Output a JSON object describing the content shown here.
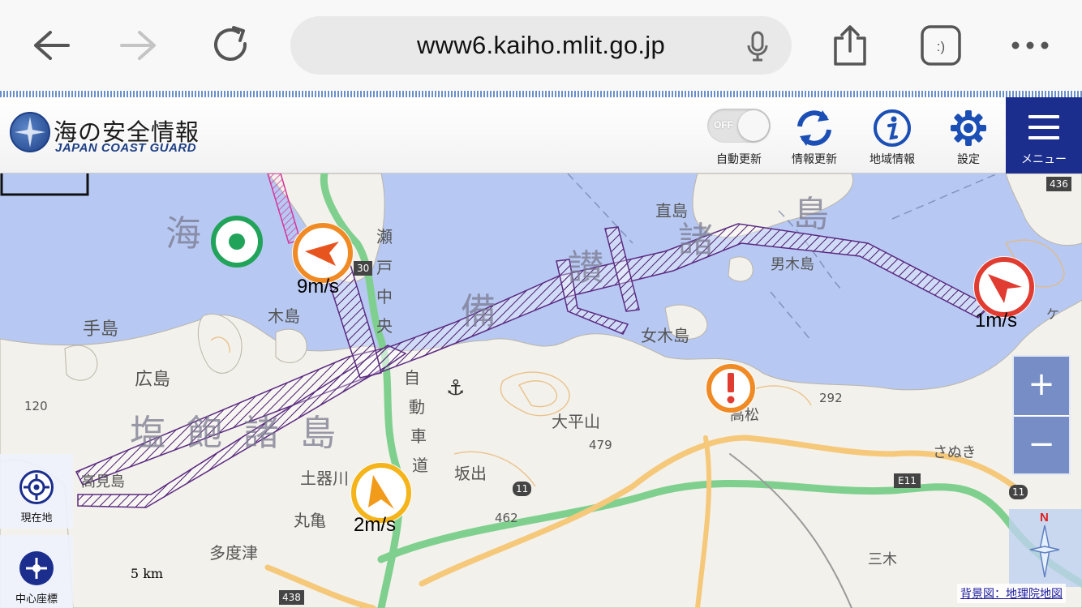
{
  "browser": {
    "url": "www6.kaiho.mlit.go.jp",
    "back_icon": "arrow-left-icon",
    "forward_icon": "arrow-right-icon",
    "reload_icon": "reload-icon",
    "mic_icon": "microphone-icon",
    "share_icon": "share-icon",
    "tabs_icon": "tab-smiley-icon",
    "tabs_label": ":)",
    "more_icon": "more-dots-icon"
  },
  "header": {
    "logo_title": "海の安全情報",
    "logo_subtitle": "JAPAN COAST GUARD",
    "toggle_state": "OFF",
    "auto_update": "自動更新",
    "info_update": "情報更新",
    "area_info": "地域情報",
    "settings": "設定",
    "menu": "メニュー",
    "accent_color": "#1b2e8e"
  },
  "map": {
    "winds": [
      {
        "label": "9m/s",
        "color": "#f08a24"
      },
      {
        "label": "1m/s",
        "color": "#e03c31"
      },
      {
        "label": "2m/s",
        "color": "#f4b41a"
      }
    ],
    "places": {
      "sea_chars": "海",
      "bisan": [
        "備",
        "讃",
        "諸",
        "島"
      ],
      "shiwaku": "塩 飽 諸 島",
      "tejima": "手島",
      "hiroshima": "広島",
      "kijima": "木島",
      "onnagi": "女木島",
      "ogi": "男木島",
      "naoshima": "直島",
      "taheisan": "大平山",
      "tsuchiki": "土器川",
      "takamijima": "高見島",
      "sakaide": "坂出",
      "marugame": "丸亀",
      "tadotsu": "多度津",
      "sanuki": "さぬき",
      "takamatsu": "高松",
      "mitoyo": "三木",
      "seto_vertical": [
        "瀬",
        "戸",
        "中",
        "央"
      ],
      "jidosha": [
        "自",
        "動",
        "車",
        "道"
      ],
      "elev_479": "479",
      "elev_462": "462",
      "elev_292": "292",
      "elev_120": "120",
      "route_11a": "11",
      "route_11b": "11",
      "route_e11": "E11",
      "route_30": "30",
      "route_436": "436",
      "route_438": "438",
      "kagawa_label": "ケ"
    },
    "scale_label": "5 km",
    "credit": "背景図：地理院地図",
    "current_location": "現在地",
    "center_coord": "中心座標",
    "zoom_in": "+",
    "zoom_out": "−",
    "compass_north": "N",
    "warning_icon": "exclamation-warning-icon",
    "lighthouse_icon": "green-circle-marker-icon",
    "anchor_icon": "anchor-icon"
  }
}
